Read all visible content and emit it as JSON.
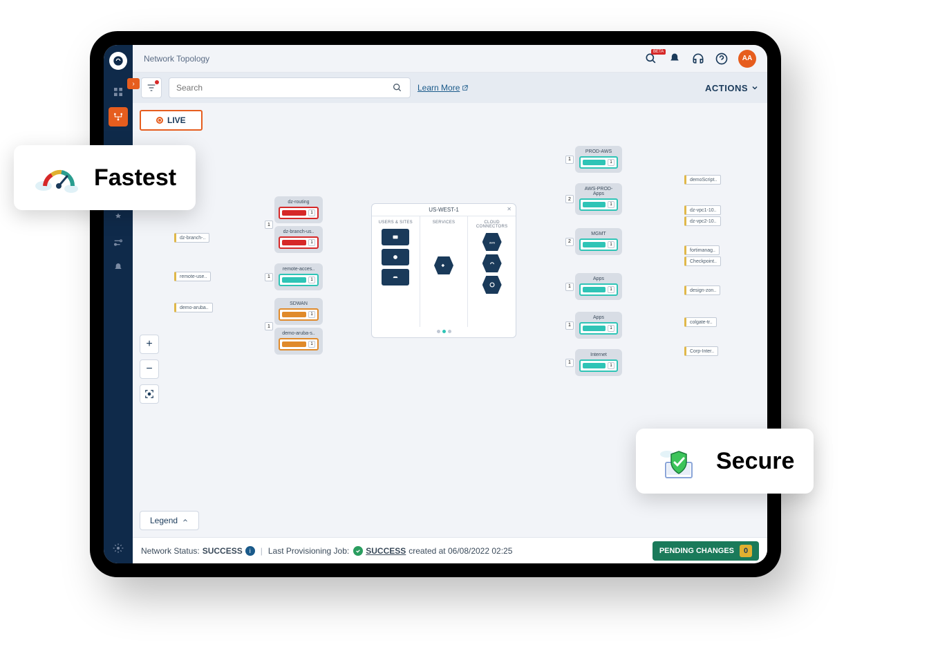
{
  "header": {
    "title": "Network Topology",
    "avatar": "AA",
    "beta": "BETA"
  },
  "toolbar": {
    "search_placeholder": "Search",
    "learn_more": "Learn More",
    "actions": "ACTIONS"
  },
  "live_tab": "LIVE",
  "legend": "Legend",
  "region": {
    "title": "US-WEST-1",
    "cols": [
      "USERS & SITES",
      "SERVICES",
      "CLOUD CONNECTORS"
    ]
  },
  "left_nodes": [
    {
      "label": "dz-routing",
      "badge": "1"
    },
    {
      "label": "dz-branch-us..",
      "badge": ""
    },
    {
      "label": "remote-acces..",
      "badge": "1"
    },
    {
      "label": "SDWAN",
      "badge": "1"
    },
    {
      "label": "demo-aruba-s..",
      "badge": ""
    }
  ],
  "left_tags": [
    "dz-branch-..",
    "remote-use..",
    "demo-aruba.."
  ],
  "right_nodes": [
    {
      "label": "PROD-AWS",
      "badge": "1"
    },
    {
      "label": "AWS-PROD-Apps",
      "badge": "2"
    },
    {
      "label": "MGMT",
      "badge": "2"
    },
    {
      "label": "Apps",
      "badge": "1"
    },
    {
      "label": "Apps",
      "badge": "1"
    },
    {
      "label": "Internet",
      "badge": "1"
    }
  ],
  "right_tags": [
    "demoScript..",
    "dz-vpc1-10..",
    "dz-vpc2-10..",
    "fortimanag..",
    "Checkpoint..",
    "design-zon..",
    "colgate-tr..",
    "Corp-Inter.."
  ],
  "status": {
    "label": "Network Status:",
    "value": "SUCCESS",
    "job_label": "Last Provisioning Job:",
    "job_value": "SUCCESS",
    "created": "created at 06/08/2022 02:25",
    "pending_label": "PENDING CHANGES",
    "pending_count": "0"
  },
  "overlays": {
    "fastest": "Fastest",
    "secure": "Secure"
  }
}
